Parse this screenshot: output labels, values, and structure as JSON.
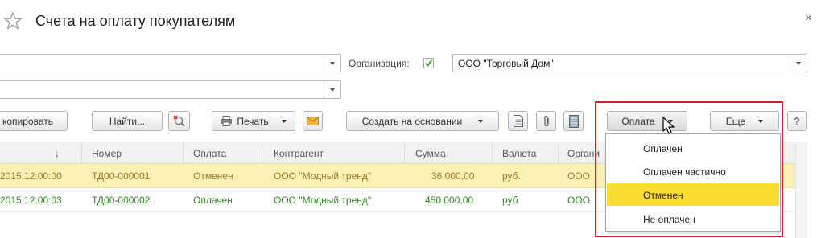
{
  "window": {
    "title": "Счета на оплату покупателям",
    "close_glyph": "×"
  },
  "filters": {
    "organization_label": "Организация:",
    "organization_value": "ООО \"Торговый Дом\""
  },
  "toolbar": {
    "copy_label": "копировать",
    "find_label": "Найти...",
    "print_label": "Печать",
    "create_based_label": "Создать на основании",
    "payment_label": "Оплата",
    "more_label": "Еще",
    "help_label": "?"
  },
  "table": {
    "headers": {
      "date": "↓",
      "number": "Номер",
      "payment": "Оплата",
      "contractor": "Контрагент",
      "sum": "Сумма",
      "currency": "Валюта",
      "org": "Органи"
    },
    "rows": [
      {
        "date": "2015 12:00:00",
        "number": "ТД00-000001",
        "payment": "Отменен",
        "contractor": "ООО \"Модный тренд\"",
        "sum": "36 000,00",
        "currency": "руб.",
        "org": "ООО"
      },
      {
        "date": "2015 12:00:03",
        "number": "ТД00-000002",
        "payment": "Оплачен",
        "contractor": "ООО \"Модный тренд\"",
        "sum": "450 000,00",
        "currency": "руб.",
        "org": "ООО"
      }
    ]
  },
  "payment_menu": {
    "items": [
      {
        "label": "Оплачен",
        "selected": false
      },
      {
        "label": "Оплачен частично",
        "selected": false
      },
      {
        "label": "Отменен",
        "selected": true
      },
      {
        "label": "Не оплачен",
        "selected": false
      }
    ]
  },
  "colors": {
    "highlight_row": "#fbf1b4",
    "menu_selected": "#fbdc30",
    "annotation_box": "#d8202a",
    "paid_text": "#2e8b20",
    "cancelled_text": "#a0792b"
  }
}
